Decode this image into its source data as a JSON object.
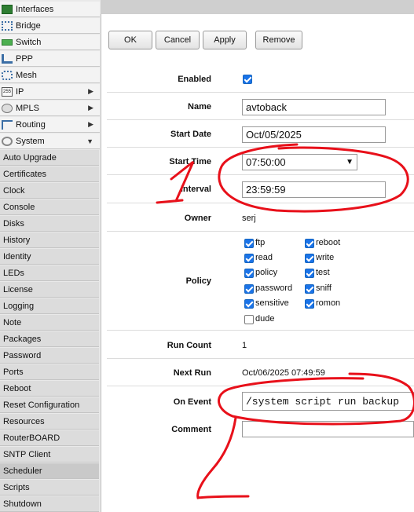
{
  "sidebar": {
    "items": [
      {
        "label": "Interfaces",
        "icon": "interfaces-icon",
        "arrow": ""
      },
      {
        "label": "Bridge",
        "icon": "bridge-icon",
        "arrow": ""
      },
      {
        "label": "Switch",
        "icon": "switch-icon",
        "arrow": ""
      },
      {
        "label": "PPP",
        "icon": "ppp-icon",
        "arrow": ""
      },
      {
        "label": "Mesh",
        "icon": "mesh-icon",
        "arrow": ""
      },
      {
        "label": "IP",
        "icon": "ip-icon",
        "arrow": "▶"
      },
      {
        "label": "MPLS",
        "icon": "mpls-icon",
        "arrow": "▶"
      },
      {
        "label": "Routing",
        "icon": "routing-icon",
        "arrow": "▶"
      },
      {
        "label": "System",
        "icon": "system-gear-icon",
        "arrow": "▼"
      }
    ],
    "subitems": [
      "Auto Upgrade",
      "Certificates",
      "Clock",
      "Console",
      "Disks",
      "History",
      "Identity",
      "LEDs",
      "License",
      "Logging",
      "Note",
      "Packages",
      "Password",
      "Ports",
      "Reboot",
      "Reset Configuration",
      "Resources",
      "RouterBOARD",
      "SNTP Client",
      "Scheduler",
      "Scripts",
      "Shutdown"
    ],
    "active_subitem": "Scheduler"
  },
  "toolbar": {
    "ok": "OK",
    "cancel": "Cancel",
    "apply": "Apply",
    "remove": "Remove"
  },
  "form": {
    "enabled_label": "Enabled",
    "enabled": true,
    "name_label": "Name",
    "name_value": "avtoback",
    "start_date_label": "Start Date",
    "start_date_value": "Oct/05/2025",
    "start_time_label": "Start Time",
    "start_time_value": "07:50:00",
    "interval_label": "Interval",
    "interval_value": "23:59:59",
    "owner_label": "Owner",
    "owner_value": "serj",
    "policy_label": "Policy",
    "policies": [
      {
        "name": "ftp",
        "checked": true
      },
      {
        "name": "reboot",
        "checked": true
      },
      {
        "name": "read",
        "checked": true
      },
      {
        "name": "write",
        "checked": true
      },
      {
        "name": "policy",
        "checked": true
      },
      {
        "name": "test",
        "checked": true
      },
      {
        "name": "password",
        "checked": true
      },
      {
        "name": "sniff",
        "checked": true
      },
      {
        "name": "sensitive",
        "checked": true
      },
      {
        "name": "romon",
        "checked": true
      },
      {
        "name": "dude",
        "checked": false
      }
    ],
    "run_count_label": "Run Count",
    "run_count_value": "1",
    "next_run_label": "Next Run",
    "next_run_value": "Oct/06/2025 07:49:59",
    "on_event_label": "On Event",
    "on_event_value": "/system script run backup",
    "comment_label": "Comment",
    "comment_value": ""
  },
  "annotations": {
    "mark_1": "1",
    "mark_2": "2",
    "pen_color": "#e8101a"
  }
}
